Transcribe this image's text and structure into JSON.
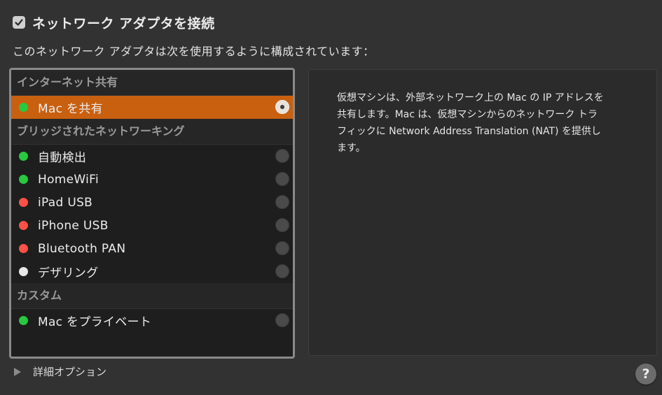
{
  "header": {
    "checkbox_checked": true,
    "title": "ネットワーク アダプタを接続",
    "subtitle": "このネットワーク アダプタは次を使用するように構成されています："
  },
  "sections": {
    "sharing": {
      "header": "インターネット共有",
      "items": [
        {
          "label": "Mac を共有",
          "status_color": "#28c840",
          "selected": true
        }
      ]
    },
    "bridged": {
      "header": "ブリッジされたネットワーキング",
      "items": [
        {
          "label": "自動検出",
          "status_color": "#28c840",
          "selected": false
        },
        {
          "label": "HomeWiFi",
          "status_color": "#28c840",
          "selected": false
        },
        {
          "label": "iPad USB",
          "status_color": "#ff5147",
          "selected": false
        },
        {
          "label": "iPhone USB",
          "status_color": "#ff5147",
          "selected": false
        },
        {
          "label": "Bluetooth PAN",
          "status_color": "#ff5147",
          "selected": false
        },
        {
          "label": "デザリング",
          "status_color": "#e8e8e8",
          "selected": false
        }
      ]
    },
    "custom": {
      "header": "カスタム",
      "items": [
        {
          "label": "Mac をプライベート",
          "status_color": "#28c840",
          "selected": false
        }
      ]
    }
  },
  "description": {
    "line1": "仮想マシンは、外部ネットワーク上の Mac の IP アドレスを",
    "line2": "共有します。Mac は、仮想マシンからのネットワーク トラ",
    "line3": "フィックに Network Address Translation (NAT) を提供し",
    "line4": "ます。"
  },
  "footer": {
    "advanced_label": "詳細オプション",
    "help_label": "?"
  },
  "colors": {
    "accent_selected": "#c8600f",
    "status_connected": "#28c840",
    "status_disconnected": "#ff5147",
    "status_unknown": "#e8e8e8"
  }
}
